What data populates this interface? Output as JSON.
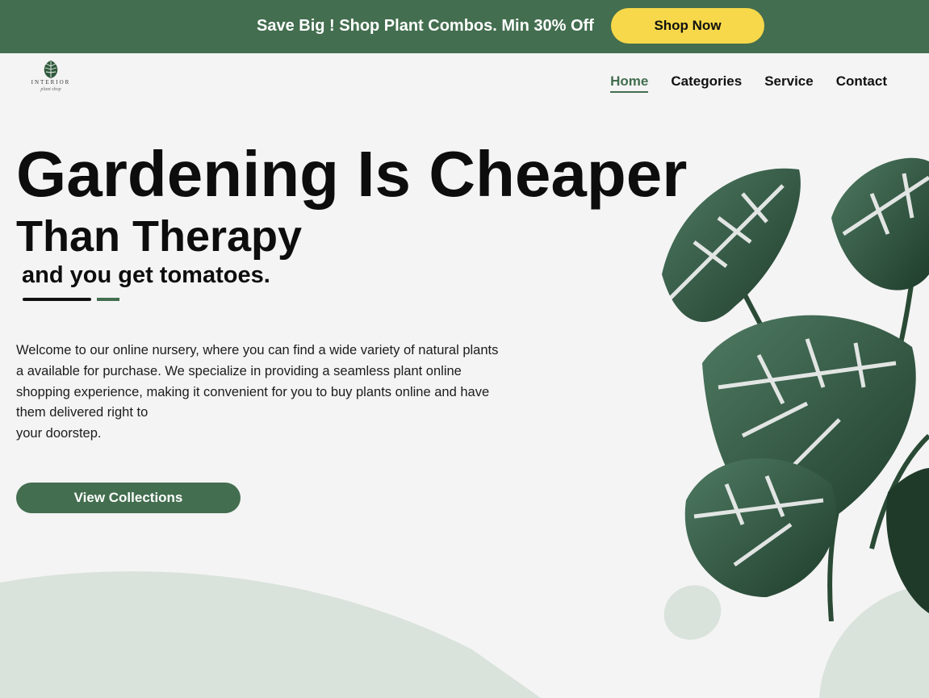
{
  "promo": {
    "text": "Save Big ! Shop Plant Combos. Min 30% Off",
    "button_label": "Shop Now"
  },
  "logo": {
    "word": "INTERIOR",
    "sub": "plant shop"
  },
  "nav": {
    "items": [
      {
        "label": "Home",
        "active": true
      },
      {
        "label": "Categories",
        "active": false
      },
      {
        "label": "Service",
        "active": false
      },
      {
        "label": "Contact",
        "active": false
      }
    ]
  },
  "hero": {
    "line1": "Gardening Is Cheaper",
    "line2": "Than Therapy",
    "subline": "and you get tomatoes.",
    "intro": "Welcome to our online nursery, where you can find a wide variety of natural plants a available for purchase. We specialize in providing a seamless plant online shopping experience, making it convenient for you to buy plants online and have them delivered right to\nyour doorstep.",
    "cta_label": "View Collections"
  },
  "colors": {
    "brand_green": "#436e4f",
    "promo_button": "#f7d84a",
    "background": "#f4f4f4",
    "shape_tint": "#d9e2db"
  },
  "icons": {
    "logo": "monstera-leaf-icon",
    "hero_image": "monstera-plant-image"
  }
}
